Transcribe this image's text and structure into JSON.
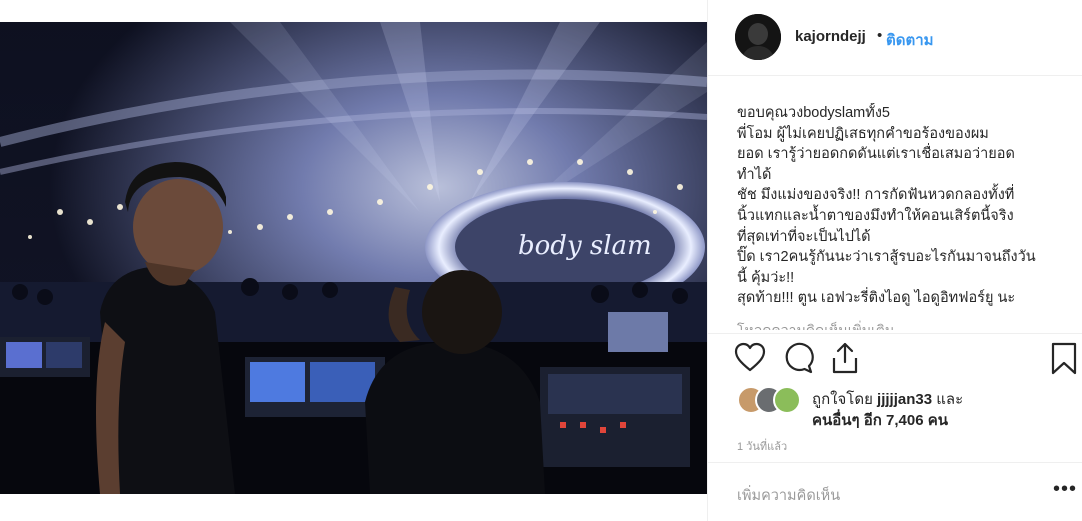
{
  "post": {
    "username": "kajorndejj",
    "separator": "•",
    "follow_label": "ติดตาม",
    "caption_lines": [
      "ขอบคุณวงbodyslamทั้ง5",
      "พี่โอม ผู้ไม่เคยปฏิเสธทุกคำขอร้องของผม",
      "ยอด เรารู้ว่ายอดกดดันแต่เราเชื่อเสมอว่ายอด",
      "ทำได้",
      "ชัช มึงแม่งของจริง!! การกัดฟันหวดกลองทั้งที่",
      "นิ้วแทกและน้ำตาของมึงทำให้คอนเสิร์ตนี้จริง",
      "ที่สุดเท่าที่จะเป็นไปได้",
      "ปิ๊ด เรา2คนรู้กันนะว่าเราสู้รบอะไรกันมาจนถึงวัน",
      "นี้ คุ้มว่ะ!!",
      "สุดท้าย!!! ตูน เอฟวะรี่ติงไอดู ไอดูอิทฟอร์ยู นะ"
    ],
    "more_comments": "โหลดความคิดเห็นเพิ่มเติม",
    "likes": {
      "prefix": "ถูกใจโดย ",
      "user": "jjjjjan33",
      "suffix": " และ",
      "others": "คนอื่นๆ อีก 7,406 คน"
    },
    "timestamp": "1 วันที่แล้ว",
    "add_comment_placeholder": "เพิ่มความคิดเห็น",
    "options_label": "•••"
  },
  "icons": [
    "heart-icon",
    "comment-icon",
    "share-icon",
    "bookmark-icon"
  ],
  "colors": {
    "link_blue": "#3897f0",
    "text": "#262626",
    "muted": "#999999",
    "divider": "#efefef"
  }
}
